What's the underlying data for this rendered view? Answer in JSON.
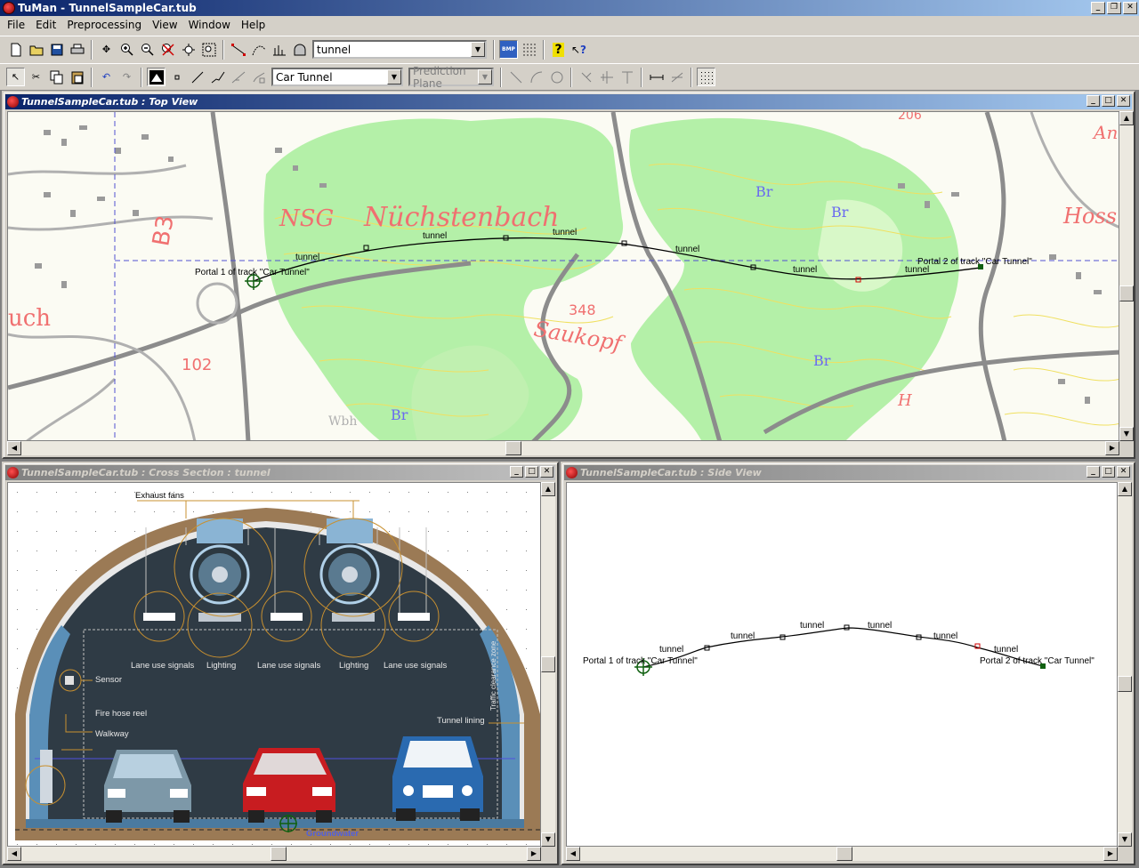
{
  "app": {
    "title": "TuMan - TunnelSampleCar.tub"
  },
  "menu": [
    "File",
    "Edit",
    "Preprocessing",
    "View",
    "Window",
    "Help"
  ],
  "toolbar1": {
    "track_combo": "tunnel",
    "bmp_label": "BMP"
  },
  "toolbar2": {
    "object_combo": "Car Tunnel",
    "plane_combo": "Prediction Plane"
  },
  "topview": {
    "title": "TunnelSampleCar.tub : Top View",
    "portal1": "Portal 1 of track \"Car Tunnel\"",
    "portal2": "Portal 2 of track \"Car Tunnel\"",
    "seg_label": "tunnel",
    "map_labels": {
      "place": "Nüchstenbach",
      "nsg": "NSG",
      "b3": "B3",
      "uch": "uch",
      "hoss": "Hoss",
      "an": "An",
      "n102": "102",
      "n206": "206",
      "n348": "348",
      "saukopf": "Saukopf",
      "br": "Br",
      "h": "H",
      "wbh": "Wbh"
    }
  },
  "crosssection": {
    "title": "TunnelSampleCar.tub : Cross Section : tunnel",
    "labels": {
      "exhaust_fans": "Exhaust fans",
      "lane_use_signals": "Lane use signals",
      "lighting": "Lighting",
      "sensor": "Sensor",
      "fire_hose_reel": "Fire hose reel",
      "walkway": "Walkway",
      "tunnel_lining": "Tunnel lining",
      "traffic_clearance_zone": "Traffic clearance zone",
      "groundwater": "Groundwater"
    }
  },
  "sideview": {
    "title": "TunnelSampleCar.tub : Side View",
    "portal1": "Portal 1 of track \"Car Tunnel\"",
    "portal2": "Portal 2 of track \"Car Tunnel\"",
    "seg_label": "tunnel"
  },
  "colors": {
    "titlebar": "#0a246a",
    "forest": "#a8f0a0",
    "contour": "#f0e060",
    "road": "#8c8c8c",
    "tunnel_wall": "#8b6a45",
    "tunnel_interior": "#2f3b45"
  }
}
